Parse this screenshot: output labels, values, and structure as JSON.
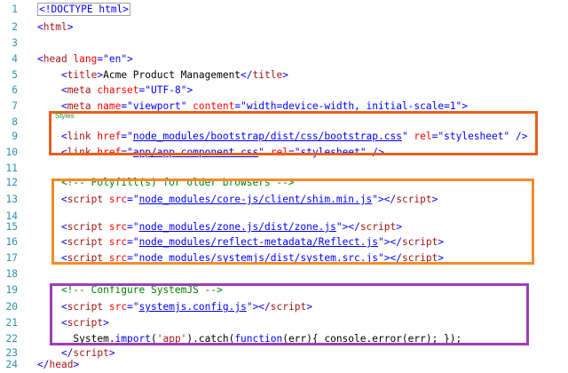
{
  "editor": {
    "lines": [
      {
        "n": "1",
        "tokens": [
          {
            "t": "<!DOCTYPE html>",
            "c": "doctype dtbox"
          }
        ]
      },
      {
        "n": "2",
        "tokens": [
          {
            "t": "<",
            "c": "br"
          },
          {
            "t": "html",
            "c": "tag"
          },
          {
            "t": ">",
            "c": "br"
          }
        ]
      },
      {
        "n": "3",
        "tokens": []
      },
      {
        "n": "4",
        "tokens": [
          {
            "t": "<",
            "c": "br"
          },
          {
            "t": "head",
            "c": "tag"
          },
          {
            "t": " lang",
            "c": "attr"
          },
          {
            "t": "=",
            "c": "br"
          },
          {
            "t": "\"en\"",
            "c": "str"
          },
          {
            "t": ">",
            "c": "br"
          }
        ]
      },
      {
        "n": "5",
        "tokens": [
          {
            "t": "    <",
            "c": "br"
          },
          {
            "t": "title",
            "c": "tag"
          },
          {
            "t": ">",
            "c": "br"
          },
          {
            "t": "Acme Product Management",
            "c": "plain"
          },
          {
            "t": "</",
            "c": "br"
          },
          {
            "t": "title",
            "c": "tag"
          },
          {
            "t": ">",
            "c": "br"
          }
        ]
      },
      {
        "n": "6",
        "tokens": [
          {
            "t": "    <",
            "c": "br"
          },
          {
            "t": "meta",
            "c": "tag"
          },
          {
            "t": " charset",
            "c": "attr"
          },
          {
            "t": "=",
            "c": "br"
          },
          {
            "t": "\"UTF-8\"",
            "c": "str"
          },
          {
            "t": ">",
            "c": "br"
          }
        ]
      },
      {
        "n": "7",
        "tokens": [
          {
            "t": "    <",
            "c": "br"
          },
          {
            "t": "meta",
            "c": "tag"
          },
          {
            "t": " name",
            "c": "attr"
          },
          {
            "t": "=",
            "c": "br"
          },
          {
            "t": "\"viewport\"",
            "c": "str"
          },
          {
            "t": " content",
            "c": "attr"
          },
          {
            "t": "=",
            "c": "br"
          },
          {
            "t": "\"width=device-width, initial-scale=1\"",
            "c": "str"
          },
          {
            "t": ">",
            "c": "br"
          }
        ]
      },
      {
        "n": "8",
        "tokens": []
      },
      {
        "n": "9",
        "tokens": [
          {
            "t": "    <",
            "c": "br"
          },
          {
            "t": "link",
            "c": "tag"
          },
          {
            "t": " href",
            "c": "attr"
          },
          {
            "t": "=",
            "c": "br"
          },
          {
            "t": "\"",
            "c": "str"
          },
          {
            "t": "node_modules/bootstrap/dist/css/bootstrap.css",
            "c": "link"
          },
          {
            "t": "\"",
            "c": "str"
          },
          {
            "t": " rel",
            "c": "attr"
          },
          {
            "t": "=",
            "c": "br"
          },
          {
            "t": "\"stylesheet\"",
            "c": "str"
          },
          {
            "t": " />",
            "c": "br"
          }
        ]
      },
      {
        "n": "10",
        "tokens": [
          {
            "t": "    <",
            "c": "br"
          },
          {
            "t": "link",
            "c": "tag"
          },
          {
            "t": " href",
            "c": "attr"
          },
          {
            "t": "=",
            "c": "br"
          },
          {
            "t": "\"",
            "c": "str"
          },
          {
            "t": "app/app.component.css",
            "c": "link"
          },
          {
            "t": "\"",
            "c": "str"
          },
          {
            "t": " rel",
            "c": "attr"
          },
          {
            "t": "=",
            "c": "br"
          },
          {
            "t": "\"stylesheet\"",
            "c": "str"
          },
          {
            "t": " />",
            "c": "br"
          }
        ]
      },
      {
        "n": "11",
        "tokens": []
      },
      {
        "n": "12",
        "tokens": [
          {
            "t": "    <!-- Polyfill(s) for older browsers -->",
            "c": "cmt"
          }
        ]
      },
      {
        "n": "13",
        "tokens": [
          {
            "t": "    <",
            "c": "br"
          },
          {
            "t": "script",
            "c": "tag"
          },
          {
            "t": " src",
            "c": "attr"
          },
          {
            "t": "=",
            "c": "br"
          },
          {
            "t": "\"",
            "c": "str"
          },
          {
            "t": "node_modules/core-js/client/shim.min.js",
            "c": "link"
          },
          {
            "t": "\"",
            "c": "str"
          },
          {
            "t": "></",
            "c": "br"
          },
          {
            "t": "script",
            "c": "tag"
          },
          {
            "t": ">",
            "c": "br"
          }
        ]
      },
      {
        "n": "14",
        "tokens": []
      },
      {
        "n": "15",
        "tokens": [
          {
            "t": "    <",
            "c": "br"
          },
          {
            "t": "script",
            "c": "tag"
          },
          {
            "t": " src",
            "c": "attr"
          },
          {
            "t": "=",
            "c": "br"
          },
          {
            "t": "\"",
            "c": "str"
          },
          {
            "t": "node_modules/zone.js/dist/zone.js",
            "c": "link"
          },
          {
            "t": "\"",
            "c": "str"
          },
          {
            "t": "></",
            "c": "br"
          },
          {
            "t": "script",
            "c": "tag"
          },
          {
            "t": ">",
            "c": "br"
          }
        ]
      },
      {
        "n": "16",
        "tokens": [
          {
            "t": "    <",
            "c": "br"
          },
          {
            "t": "script",
            "c": "tag"
          },
          {
            "t": " src",
            "c": "attr"
          },
          {
            "t": "=",
            "c": "br"
          },
          {
            "t": "\"",
            "c": "str"
          },
          {
            "t": "node_modules/reflect-metadata/Reflect.js",
            "c": "link"
          },
          {
            "t": "\"",
            "c": "str"
          },
          {
            "t": "></",
            "c": "br"
          },
          {
            "t": "script",
            "c": "tag"
          },
          {
            "t": ">",
            "c": "br"
          }
        ]
      },
      {
        "n": "17",
        "tokens": [
          {
            "t": "    <",
            "c": "br"
          },
          {
            "t": "script",
            "c": "tag"
          },
          {
            "t": " src",
            "c": "attr"
          },
          {
            "t": "=",
            "c": "br"
          },
          {
            "t": "\"",
            "c": "str"
          },
          {
            "t": "node_modules/systemjs/dist/system.src.js",
            "c": "link"
          },
          {
            "t": "\"",
            "c": "str"
          },
          {
            "t": "></",
            "c": "br"
          },
          {
            "t": "script",
            "c": "tag"
          },
          {
            "t": ">",
            "c": "br"
          }
        ]
      },
      {
        "n": "18",
        "tokens": []
      },
      {
        "n": "19",
        "tokens": [
          {
            "t": "    <!-- Configure SystemJS -->",
            "c": "cmt"
          }
        ]
      },
      {
        "n": "20",
        "tokens": [
          {
            "t": "    <",
            "c": "br"
          },
          {
            "t": "script",
            "c": "tag"
          },
          {
            "t": " src",
            "c": "attr"
          },
          {
            "t": "=",
            "c": "br"
          },
          {
            "t": "\"",
            "c": "str"
          },
          {
            "t": "systemjs.config.js",
            "c": "link"
          },
          {
            "t": "\"",
            "c": "str"
          },
          {
            "t": "></",
            "c": "br"
          },
          {
            "t": "script",
            "c": "tag"
          },
          {
            "t": ">",
            "c": "br"
          }
        ]
      },
      {
        "n": "21",
        "tokens": [
          {
            "t": "    <",
            "c": "br"
          },
          {
            "t": "script",
            "c": "tag"
          },
          {
            "t": ">",
            "c": "br"
          }
        ]
      },
      {
        "n": "22",
        "tokens": [
          {
            "t": "      System.",
            "c": "plain"
          },
          {
            "t": "import",
            "c": "br"
          },
          {
            "t": "(",
            "c": "plain"
          },
          {
            "t": "'app'",
            "c": "tag"
          },
          {
            "t": ").catch(",
            "c": "plain"
          },
          {
            "t": "function",
            "c": "br"
          },
          {
            "t": "(err){ console.error(err); });",
            "c": "plain"
          }
        ]
      },
      {
        "n": "23",
        "tokens": [
          {
            "t": "    </",
            "c": "br"
          },
          {
            "t": "script",
            "c": "tag"
          },
          {
            "t": ">",
            "c": "br"
          }
        ]
      },
      {
        "n": "24",
        "tokens": [
          {
            "t": "</",
            "c": "br"
          },
          {
            "t": "head",
            "c": "tag"
          },
          {
            "t": ">",
            "c": "br"
          }
        ]
      }
    ]
  },
  "annotations": {
    "styles_label": "Styles",
    "colors": {
      "styles_box": "#e8601c",
      "scripts_box": "#f28c28",
      "config_box": "#9b3fb5"
    }
  }
}
